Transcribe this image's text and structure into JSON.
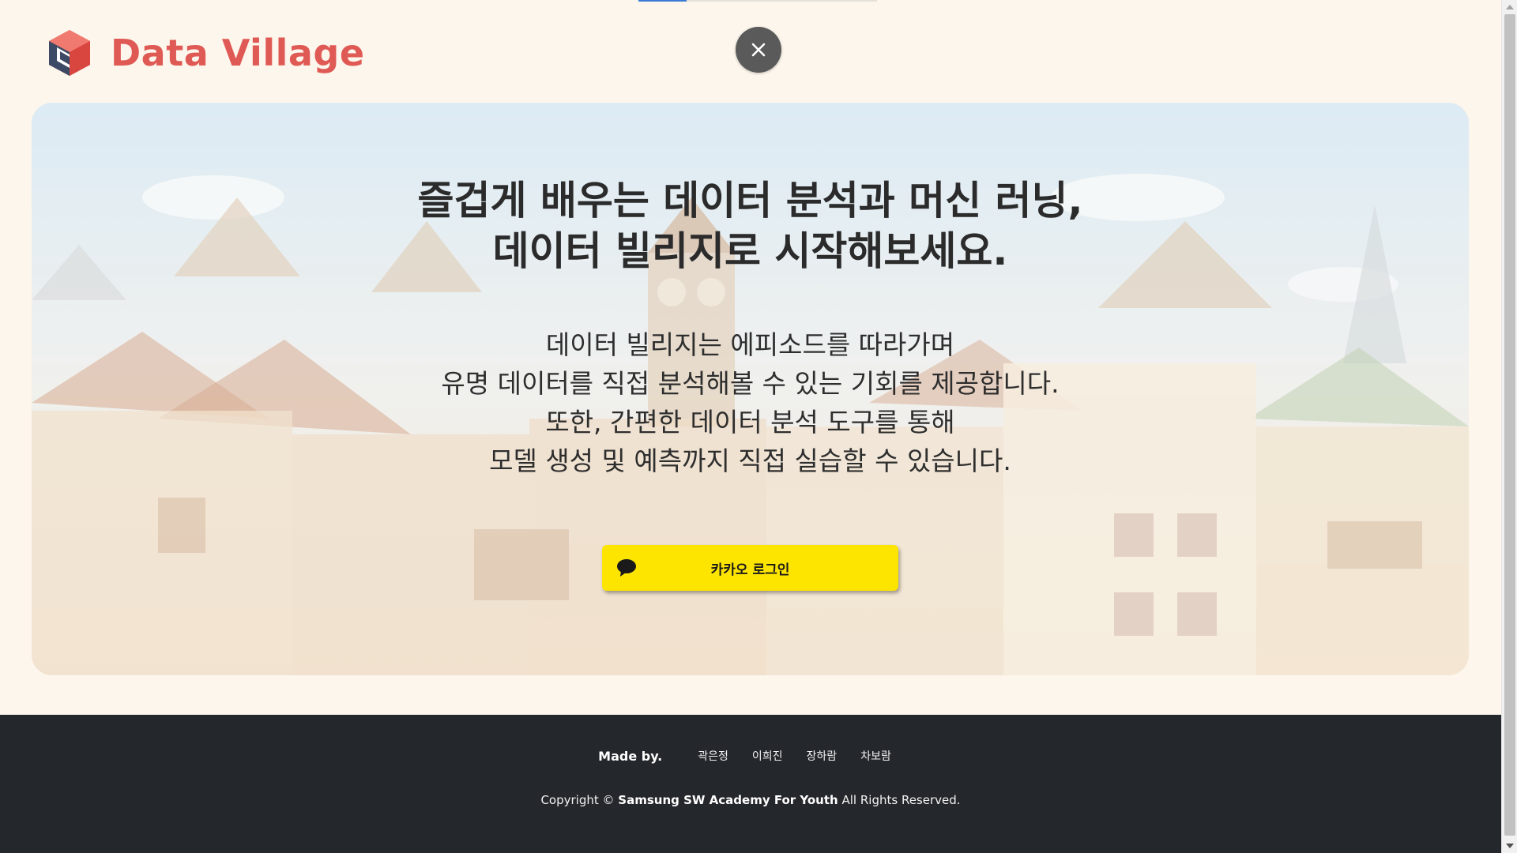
{
  "header": {
    "brand": "Data Village",
    "brand_color": "#e05a55",
    "logo_icon": "data-village-logo-icon",
    "close_icon": "close-icon"
  },
  "hero": {
    "title_line1": "즐겁게 배우는 데이터 분석과 머신 러닝,",
    "title_line2": "데이터 빌리지로 시작해보세요.",
    "desc_lines": [
      "데이터 빌리지는 에피소드를 따라가며",
      "유명 데이터를 직접 분석해볼 수 있는 기회를 제공합니다.",
      "또한, 간편한 데이터 분석 도구를 통해",
      "모델 생성 및 예측까지 직접 실습할 수 있습니다."
    ],
    "login_button": "카카오 로그인",
    "login_button_color": "#fee500",
    "login_icon": "kakao-chat-bubble-icon"
  },
  "footer": {
    "made_by_label": "Made by.",
    "members": [
      "곽은정",
      "이희진",
      "장하람",
      "차보람"
    ],
    "copyright_prefix": "Copyright ©",
    "copyright_org": "Samsung SW Academy For Youth",
    "copyright_suffix": "All Rights Reserved.",
    "background_color": "#24272b"
  }
}
